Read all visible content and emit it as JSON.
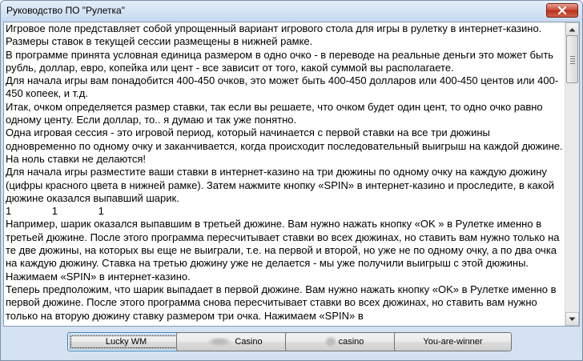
{
  "window": {
    "title": "Руководство ПО \"Рулетка\""
  },
  "content": {
    "text": "Игровое поле представляет собой упрощенный вариант игрового стола для игры в рулетку в интернет-казино. Размеры ставок в текущей сессии размещены в нижней рамке.\nВ программе принята условная единица размером в одно очко - в переводе на реальные деньги это может быть рубль, доллар, евро, копейка или цент - все зависит от того, какой суммой вы располагаете.\nДля начала игры вам понадобится 400-450 очков, это может быть 400-450 долларов или 400-450 центов или 400-450 копеек, и т.д.\nИтак, очком определяется размер ставки, так если вы решаете, что очком будет один цент, то одно очко равно одному центу. Если доллар, то.. я думаю и так уже понятно.\nОдна игровая сессия - это игровой период, который начинается с первой ставки на все три дюжины одновременно по одному очку и заканчивается, когда происходит последовательный выигрыш на каждой дюжине. На ноль ставки не делаются!\nДля начала игры разместите ваши ставки в интернет-казино на три дюжины по одному очку на каждую дюжину (цифры красного цвета в нижней рамке). Затем нажмите кнопку «SPIN» в интернет-казино и проследите, в какой дюжине оказался выпавший шарик.\n1              1              1\nНапример, шарик оказался выпавшим в третьей дюжине. Вам нужно нажать кнопку «OK » в Рулетке именно в третьей дюжине. После этого программа пересчитывает ставки во всех дюжинах, но ставить вам нужно только на те две дюжины, на которых вы еще не выиграли, т.е. на первой и второй, но уже не по одному очку, а по два очка на каждую дюжину. Ставка на третью дюжину уже не делается - мы уже получили выигрыш с этой дюжины. Нажимаем «SPIN» в интернет-казино.\nТеперь предположим, что шарик выпадает в первой дюжине. Вам нужно нажать кнопку «OK» в Рулетке именно в первой дюжине. После этого программа снова пересчитывает ставки во всех дюжинах, но ставить вам нужно только на вторую дюжину ставку размером три очка. Нажимаем «SPIN» в"
  },
  "buttons": {
    "lucky_wm": "Lucky WM",
    "casino1": "Casino",
    "casino2": "casino",
    "you_are_winner": "You-are-winner"
  },
  "icons": {
    "close": "close-icon",
    "scroll_up": "arrow-up-icon",
    "scroll_down": "arrow-down-icon"
  },
  "colors": {
    "close_button": "#c9442f",
    "titlebar": "#cfe0f2"
  }
}
